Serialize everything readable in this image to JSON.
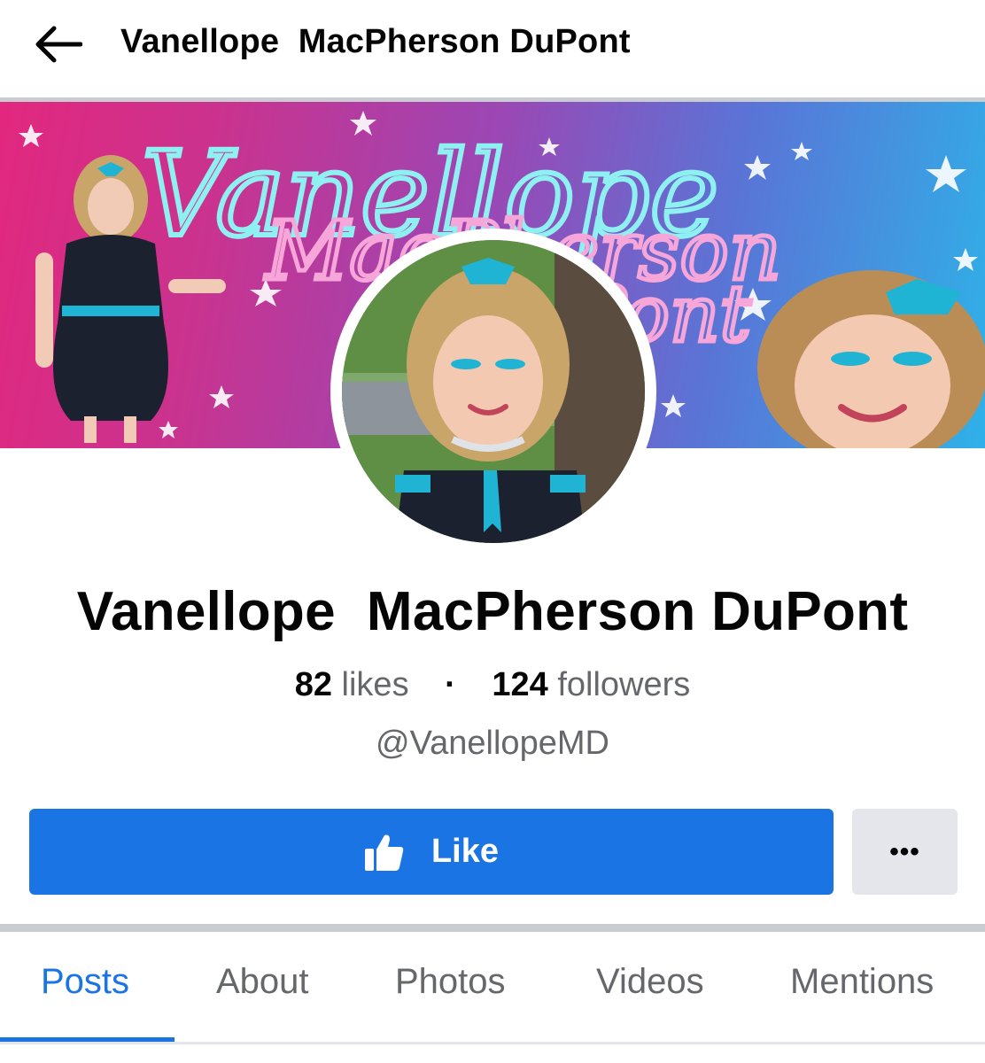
{
  "header": {
    "title": "Vanellope  MacPherson DuPont",
    "back_icon": "arrow-left-icon"
  },
  "cover": {
    "script_line1": "Vanellope",
    "script_line2": "MacPherson",
    "script_line3": "DuPont",
    "colors": {
      "left": "#e2287e",
      "right": "#2fb1e8",
      "script_cyan": "#8ff0f2",
      "script_pink": "#f6a6d8"
    }
  },
  "profile": {
    "name": "Vanellope  MacPherson DuPont",
    "likes_count": "82",
    "likes_label": "likes",
    "separator": "·",
    "followers_count": "124",
    "followers_label": "followers",
    "handle": "@VanellopeMD"
  },
  "actions": {
    "like_label": "Like",
    "like_icon": "thumbs-up-icon",
    "more_label": "•••",
    "accent": "#1b74e4"
  },
  "tabs": [
    {
      "label": "Posts",
      "active": true
    },
    {
      "label": "About",
      "active": false
    },
    {
      "label": "Photos",
      "active": false
    },
    {
      "label": "Videos",
      "active": false
    },
    {
      "label": "Mentions",
      "active": false
    }
  ]
}
